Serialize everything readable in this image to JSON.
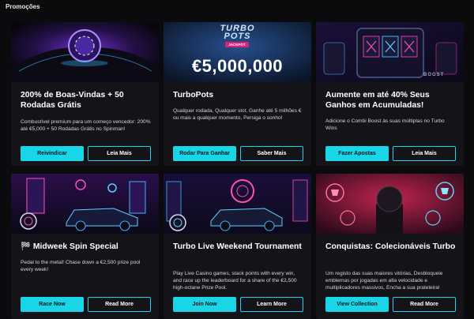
{
  "section": {
    "title": "Promoções"
  },
  "cards": [
    {
      "title": "200% de Boas-Vindas + 50 Rodadas Grátis",
      "desc": "Combustível premium para um começo vencedor: 200% até €5,000 + 50 Rodadas Grátis no Spinman!",
      "primary": "Reivindicar",
      "secondary": "Leia Mais"
    },
    {
      "title": "TurboPots",
      "desc": "Qualquer rodada, Qualquer slot, Ganhe até 5 milhões € ou mais a qualquer momento, Persiga o sonho!",
      "primary": "Rodar Para Ganhar",
      "secondary": "Saber Mais",
      "banner": {
        "logo_top": "TURBO",
        "logo_bottom": "POTS",
        "logo_tag": "JACKPOT",
        "amount": "€5,000,000"
      }
    },
    {
      "title": "Aumente em até 40% Seus Ganhos em Acumuladas!",
      "desc": "Adicione o Combi Boost às suas múltiplas no Turbo Wins",
      "primary": "Fazer Apostas",
      "secondary": "Leia Mais",
      "banner": {
        "sign": "BOOST"
      }
    },
    {
      "title": "🏁 Midweek Spin Special",
      "desc": "Pedal to the metal! Chase down a €2,500 prize pool every week!",
      "primary": "Race Now",
      "secondary": "Read More"
    },
    {
      "title": "Turbo Live Weekend Tournament",
      "desc": "Play Live Casino games, stack points with every win, and race up the leaderboard for a share of the €2,500 high-octane Prize Pool.",
      "primary": "Join Now",
      "secondary": "Learn More"
    },
    {
      "title": "Conquistas: Colecionáveis Turbo",
      "desc": "Um registo das suas maiores vitórias, Desbloqueie emblemas por jogadas em alta velocidade e multiplicadores massivos, Encha a sua prateleira!",
      "primary": "View Collection",
      "secondary": "Read More"
    }
  ],
  "colors": {
    "accent": "#19d5e8",
    "background": "#0b0b0d",
    "card": "#141418"
  }
}
